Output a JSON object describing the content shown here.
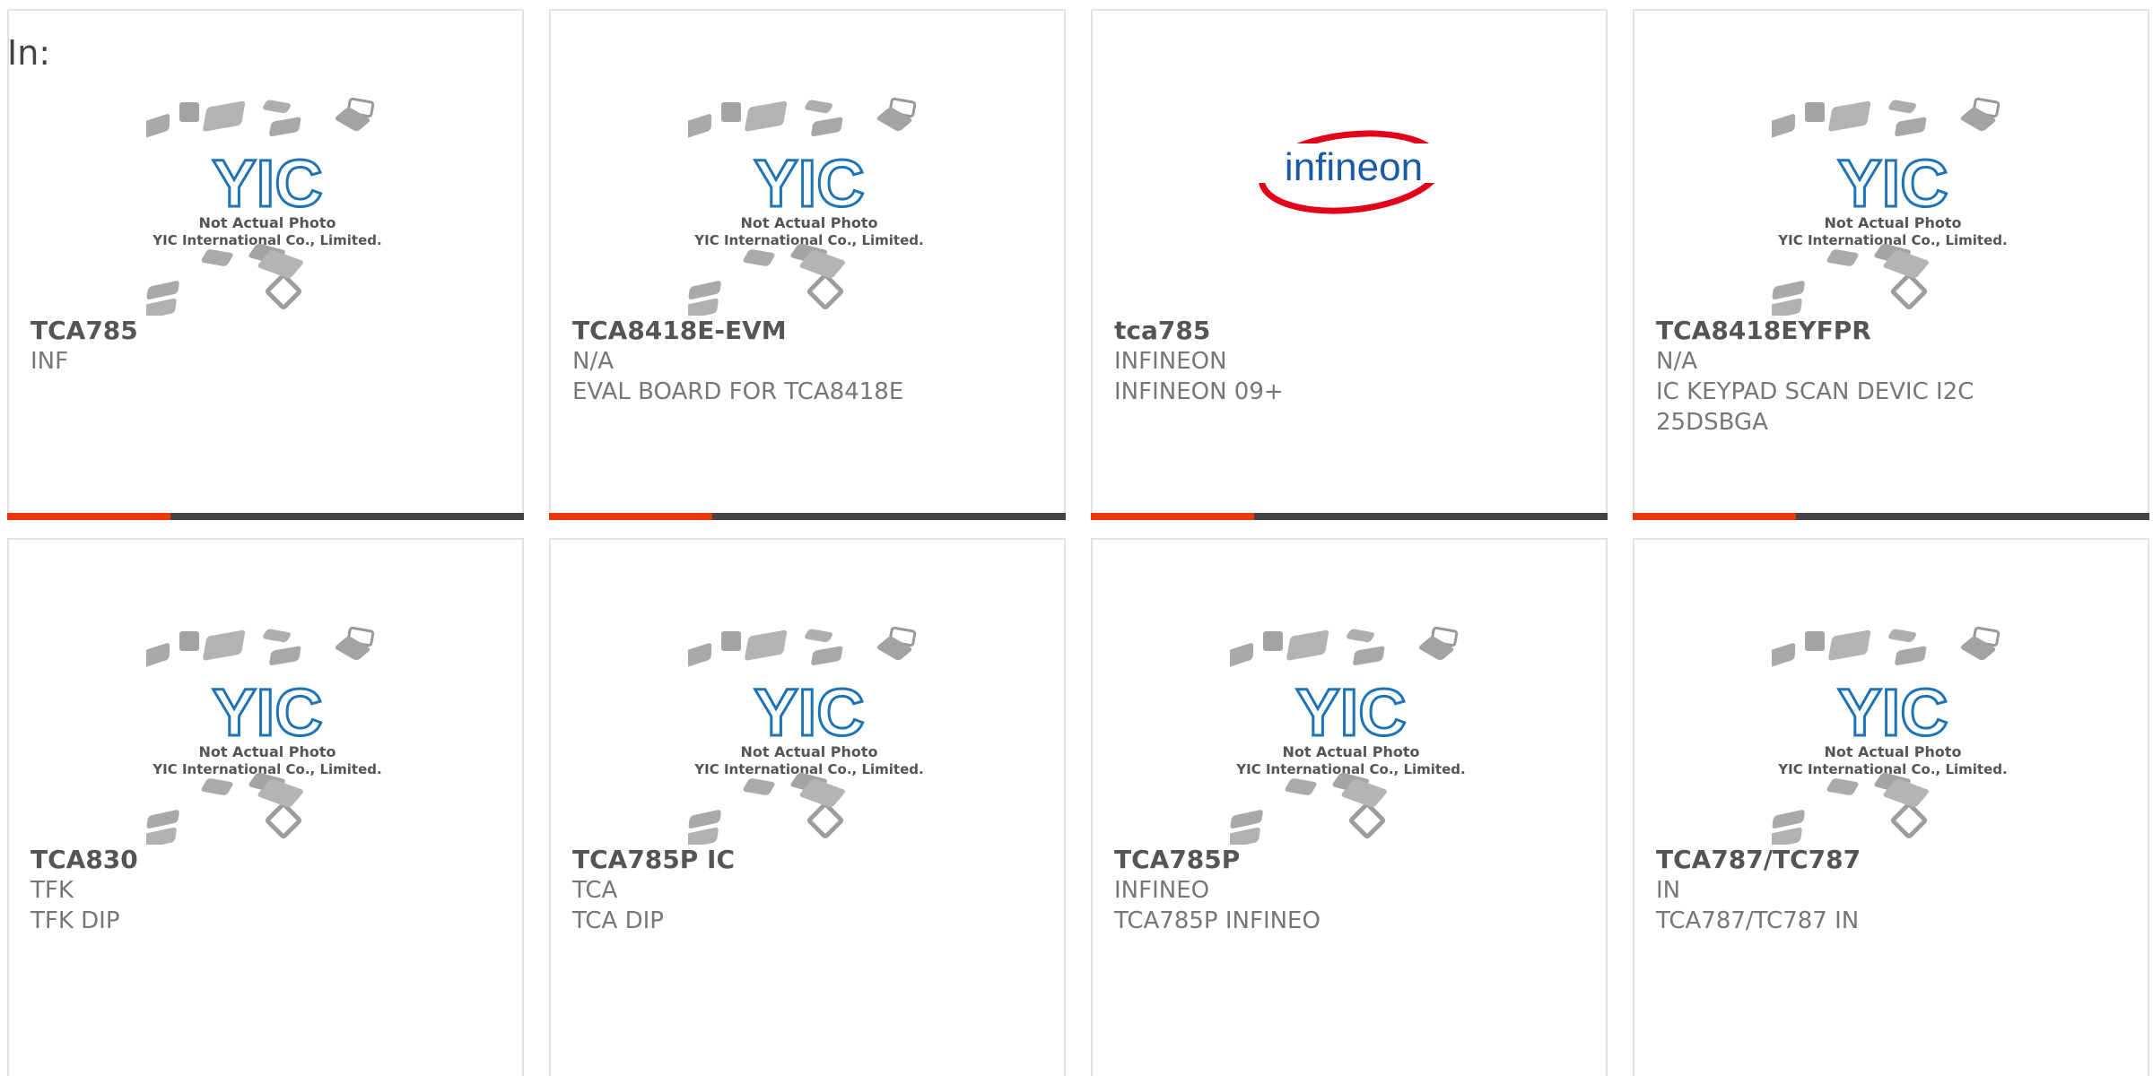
{
  "header": {
    "label": "In:"
  },
  "theme": {
    "accent": "#e8380d",
    "bar_base": "#444444"
  },
  "placeholder": {
    "brand": "YIC",
    "line1": "Not Actual Photo",
    "line2": "YIC International Co., Limited."
  },
  "logo": {
    "text": "infineon",
    "ring": "#e2001a",
    "text_color": "#1b5aa5"
  },
  "products": [
    {
      "part": "TCA785",
      "line1": "INF",
      "line2": "",
      "line3": "",
      "image": "placeholder"
    },
    {
      "part": "TCA8418E-EVM",
      "line1": "N/A",
      "line2": "EVAL BOARD FOR TCA8418E",
      "line3": "",
      "image": "placeholder"
    },
    {
      "part": "tca785",
      "line1": "INFINEON",
      "line2": "INFINEON 09+",
      "line3": "",
      "image": "infineon-logo"
    },
    {
      "part": "TCA8418EYFPR",
      "line1": "N/A",
      "line2": "IC KEYPAD SCAN DEVIC I2C",
      "line3": "25DSBGA",
      "image": "placeholder"
    },
    {
      "part": "TCA830",
      "line1": "TFK",
      "line2": "TFK DIP",
      "line3": "",
      "image": "placeholder"
    },
    {
      "part": "TCA785P IC",
      "line1": "TCA",
      "line2": "TCA DIP",
      "line3": "",
      "image": "placeholder"
    },
    {
      "part": "TCA785P",
      "line1": "INFINEO",
      "line2": "TCA785P INFINEO",
      "line3": "",
      "image": "placeholder"
    },
    {
      "part": "TCA787/TC787",
      "line1": "IN",
      "line2": "TCA787/TC787 IN",
      "line3": "",
      "image": "placeholder"
    }
  ]
}
